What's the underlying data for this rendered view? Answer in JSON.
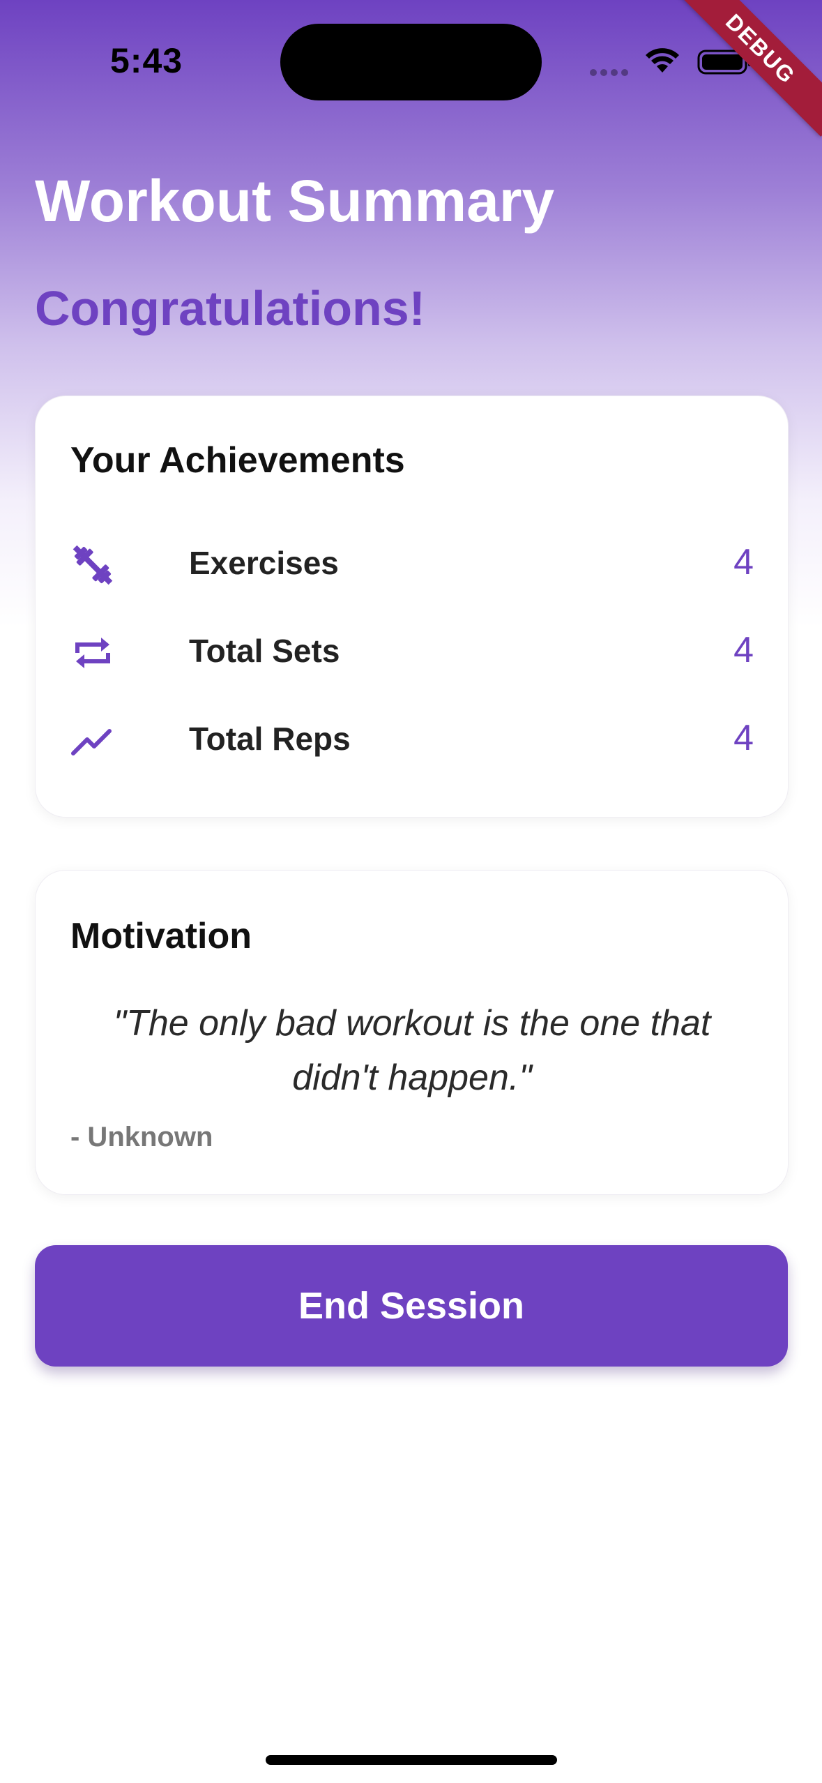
{
  "status_bar": {
    "time": "5:43",
    "debug_label": "DEBUG"
  },
  "header": {
    "title": "Workout Summary",
    "subtitle": "Congratulations!"
  },
  "achievements": {
    "title": "Your Achievements",
    "items": [
      {
        "icon": "dumbbell-icon",
        "label": "Exercises",
        "value": "4"
      },
      {
        "icon": "repeat-icon",
        "label": "Total Sets",
        "value": "4"
      },
      {
        "icon": "trending-up-icon",
        "label": "Total Reps",
        "value": "4"
      }
    ]
  },
  "motivation": {
    "title": "Motivation",
    "quote": "\"The only bad workout is the one that didn't happen.\"",
    "author": "- Unknown"
  },
  "actions": {
    "end_session_label": "End Session"
  },
  "colors": {
    "accent": "#6e42c1",
    "debug_banner": "#a31d3a"
  }
}
